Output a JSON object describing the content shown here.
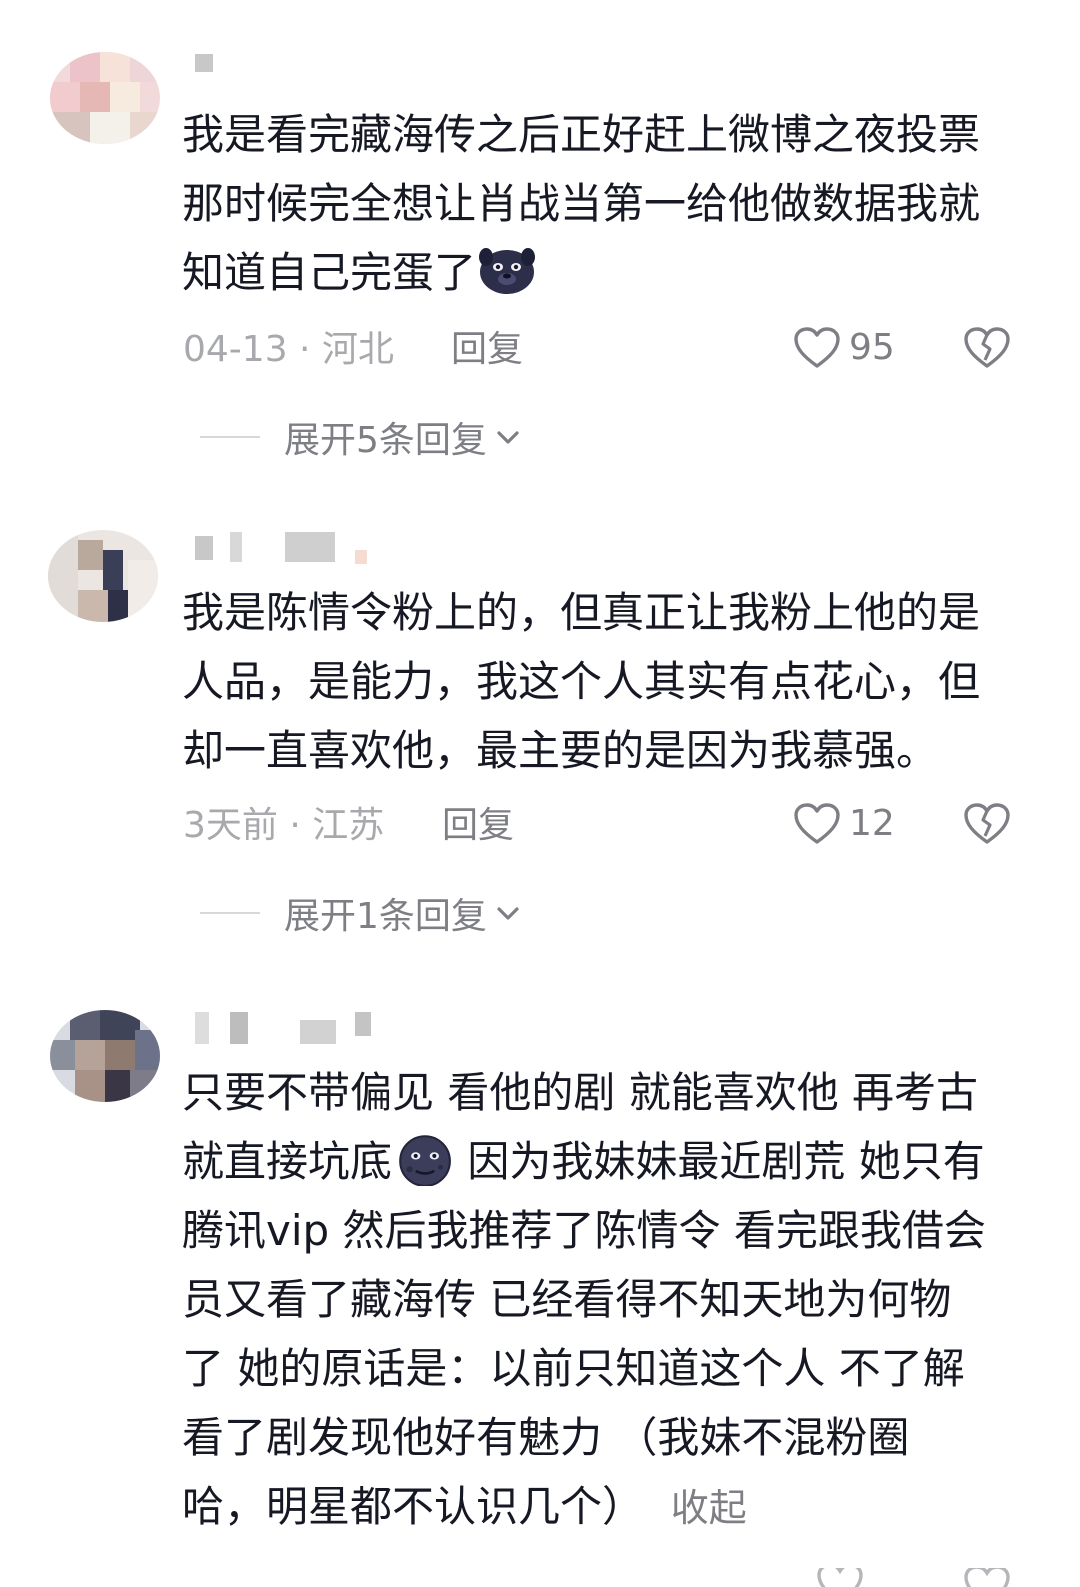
{
  "comments": [
    {
      "text": "我是看完藏海传之后正好赶上微博之夜投票\n那时候完全想让肖战当第一给他做数据我就\n知道自己完蛋了",
      "emoji": "dark-dog-face-emoji",
      "time_location": "04-13 · 河北",
      "reply_label": "回复",
      "like_count": "95",
      "expand_label": "展开5条回复"
    },
    {
      "text": "我是陈情令粉上的，但真正让我粉上他的是\n人品，是能力，我这个人其实有点花心，但\n却一直喜欢他，最主要的是因为我慕强。",
      "time_location": "3天前 · 江苏",
      "reply_label": "回复",
      "like_count": "12",
      "expand_label": "展开1条回复"
    },
    {
      "text_before_emoji": "只要不带偏见 看他的剧 就能喜欢他 再考古\n就直接坑底",
      "emoji": "new-moon-face-emoji",
      "text_after_emoji": " 因为我妹妹最近剧荒 她只有\n腾讯vip 然后我推荐了陈情令 看完跟我借会\n员又看了藏海传 已经看得不知天地为何物\n了 她的原话是：以前只知道这个人 不了解\n看了剧发现他好有魅力 （我妹不混粉圈\n哈，明星都不认识几个）",
      "collapse_label": "收起"
    }
  ],
  "colors": {
    "text_primary": "#161823",
    "text_secondary": "#a8a9ad",
    "text_action": "#7e7f84",
    "divider": "#d7d8da"
  }
}
